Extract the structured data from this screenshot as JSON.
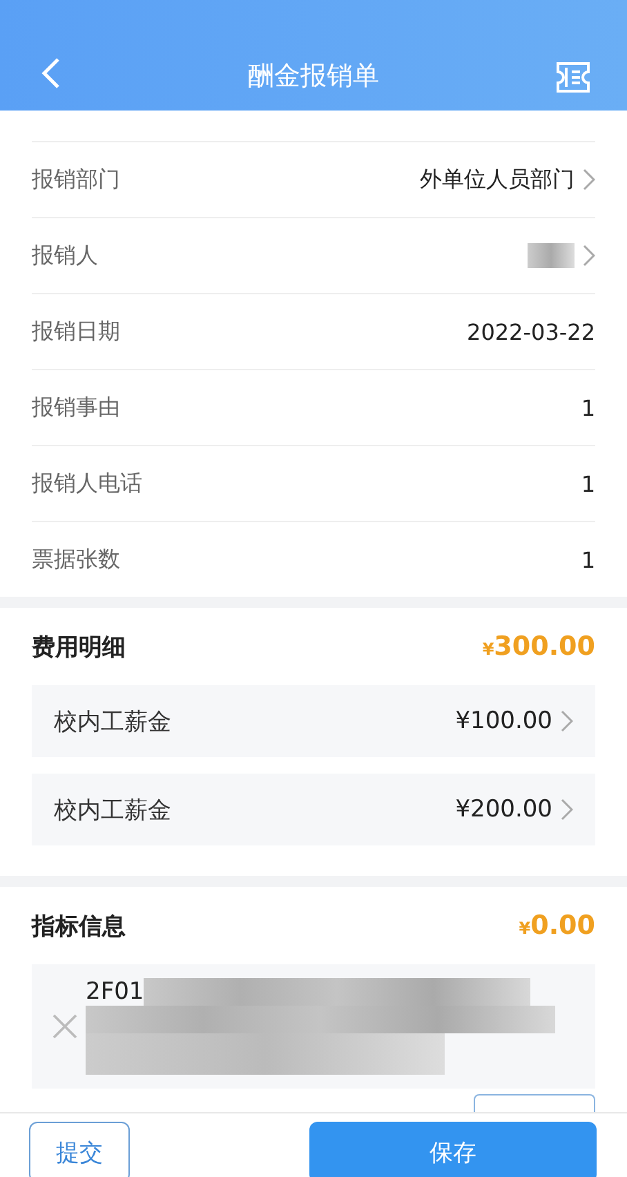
{
  "header": {
    "title": "酬金报销单"
  },
  "basic_info": {
    "rows": [
      {
        "label": "报销部门",
        "value": "外单位人员部门",
        "redacted": false,
        "link": true
      },
      {
        "label": "报销人",
        "value": "",
        "redacted": true,
        "link": true
      },
      {
        "label": "报销日期",
        "value": "2022-03-22",
        "redacted": false,
        "link": false
      },
      {
        "label": "报销事由",
        "value": "1",
        "redacted": false,
        "link": false
      },
      {
        "label": "报销人电话",
        "value": "1",
        "redacted": false,
        "link": false
      },
      {
        "label": "票据张数",
        "value": "1",
        "redacted": false,
        "link": false
      }
    ]
  },
  "expense_details": {
    "title": "费用明细",
    "currency": "¥",
    "total": "300.00",
    "items": [
      {
        "name": "校内工薪金",
        "amount": "¥100.00"
      },
      {
        "name": "校内工薪金",
        "amount": "¥200.00"
      }
    ]
  },
  "indicator_info": {
    "title": "指标信息",
    "currency": "¥",
    "total": "0.00",
    "entries": [
      {
        "code": "2F01"
      }
    ]
  },
  "footer": {
    "buttons": [
      {
        "label": "提交",
        "kind": "outline"
      },
      {
        "label": "保存",
        "kind": "primary"
      }
    ]
  }
}
